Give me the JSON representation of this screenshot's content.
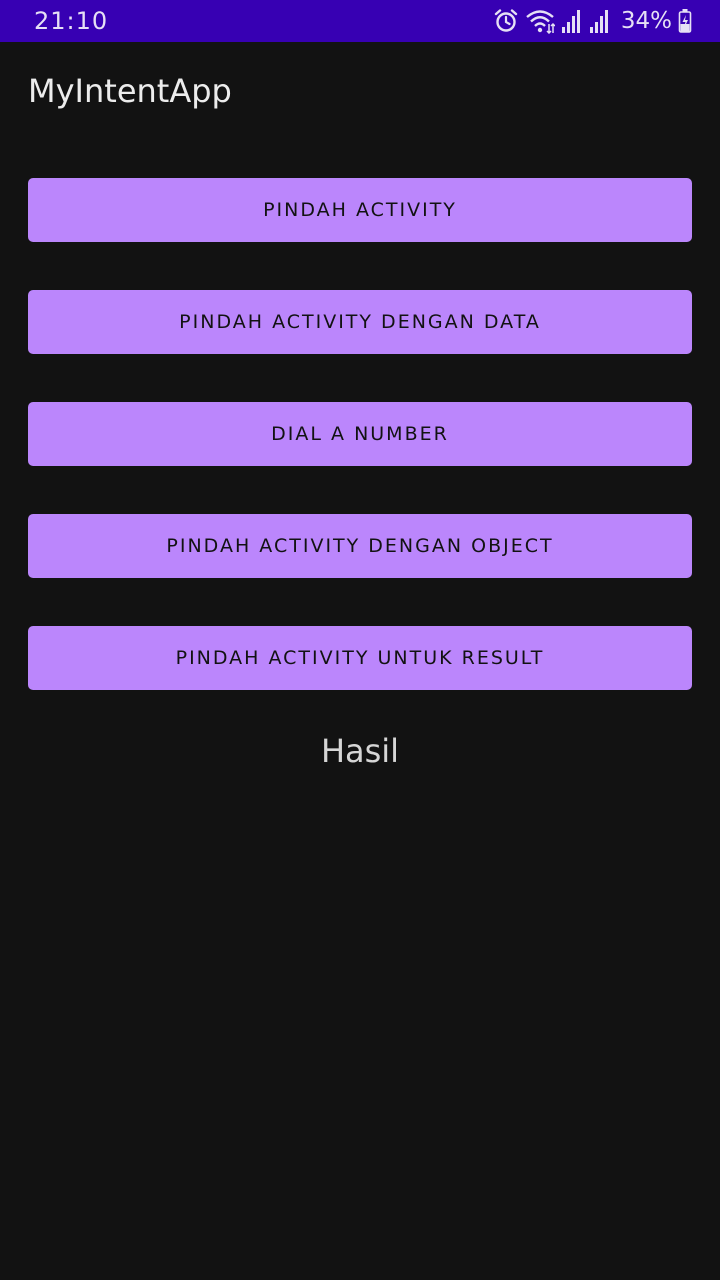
{
  "status_bar": {
    "time": "21:10",
    "battery": "34%",
    "icons": [
      "alarm-icon",
      "wifi-icon",
      "signal-icon",
      "signal-icon",
      "battery-charging-icon"
    ]
  },
  "app_bar": {
    "title": "MyIntentApp"
  },
  "buttons": [
    {
      "label": "PINDAH ACTIVITY"
    },
    {
      "label": "PINDAH ACTIVITY DENGAN DATA"
    },
    {
      "label": "DIAL A NUMBER"
    },
    {
      "label": "PINDAH ACTIVITY DENGAN OBJECT"
    },
    {
      "label": "PINDAH ACTIVITY UNTUK RESULT"
    }
  ],
  "result": {
    "text": "Hasil"
  },
  "colors": {
    "status_bar": "#3700b3",
    "background": "#121212",
    "button": "#bb86fc",
    "button_text": "#121212"
  }
}
